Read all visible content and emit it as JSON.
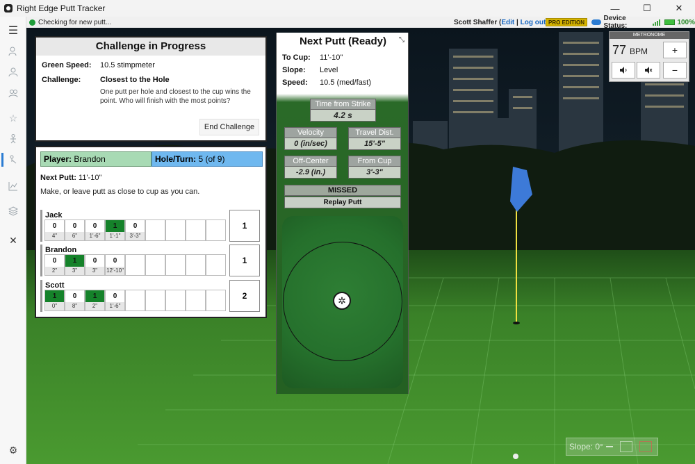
{
  "window": {
    "title": "Right Edge Putt Tracker",
    "controls": {
      "minimize": "—",
      "maximize": "☐",
      "close": "✕"
    }
  },
  "status": {
    "message": "Checking for new putt...",
    "user_name": "Scott Shaffer",
    "edit_label": "Edit",
    "separator": "|",
    "logout_label": "Log out",
    "paren_open": "(",
    "paren_close": ")",
    "edition_badge": "PRO EDITION",
    "device_label": "Device Status:",
    "battery": "100%"
  },
  "sidebar": {
    "icons": [
      "menu-icon",
      "user-settings-icon",
      "user-icon",
      "users-icon",
      "star-icon",
      "golfer-icon",
      "putt-icon",
      "chart-icon",
      "layers-icon",
      "close-icon",
      "settings-icon"
    ]
  },
  "challenge": {
    "title": "Challenge in Progress",
    "green_speed_label": "Green Speed:",
    "green_speed_value": "10.5 stimpmeter",
    "challenge_label": "Challenge:",
    "challenge_name": "Closest to the Hole",
    "challenge_desc": "One putt per hole and closest to the cup wins the point. Who will finish with the most points?",
    "end_button": "End Challenge"
  },
  "turn": {
    "player_label": "Player:",
    "player_name": "Brandon",
    "hole_label": "Hole/Turn:",
    "hole_value": "5 (of 9)",
    "next_putt_label": "Next Putt:",
    "next_putt_value": "11'-10\"",
    "instruction": "Make, or leave putt as close to cup as you can."
  },
  "scoreboard": [
    {
      "name": "Jack",
      "total": "1",
      "holes": [
        {
          "score": "0",
          "dist": "4\"",
          "made": false
        },
        {
          "score": "0",
          "dist": "6\"",
          "made": false
        },
        {
          "score": "0",
          "dist": "1'-6\"",
          "made": false
        },
        {
          "score": "1",
          "dist": "1'-1\"",
          "made": true
        },
        {
          "score": "0",
          "dist": "3'-3\"",
          "made": false
        },
        {
          "score": "",
          "dist": "",
          "made": false
        },
        {
          "score": "",
          "dist": "",
          "made": false
        },
        {
          "score": "",
          "dist": "",
          "made": false
        },
        {
          "score": "",
          "dist": "",
          "made": false
        }
      ]
    },
    {
      "name": "Brandon",
      "total": "1",
      "holes": [
        {
          "score": "0",
          "dist": "2\"",
          "made": false
        },
        {
          "score": "1",
          "dist": "3\"",
          "made": true
        },
        {
          "score": "0",
          "dist": "3\"",
          "made": false
        },
        {
          "score": "0",
          "dist": "12'-10\"",
          "made": false
        },
        {
          "score": "",
          "dist": "",
          "made": false
        },
        {
          "score": "",
          "dist": "",
          "made": false
        },
        {
          "score": "",
          "dist": "",
          "made": false
        },
        {
          "score": "",
          "dist": "",
          "made": false
        },
        {
          "score": "",
          "dist": "",
          "made": false
        }
      ]
    },
    {
      "name": "Scott",
      "total": "2",
      "holes": [
        {
          "score": "1",
          "dist": "0\"",
          "made": true
        },
        {
          "score": "0",
          "dist": "8\"",
          "made": false
        },
        {
          "score": "1",
          "dist": "2\"",
          "made": true
        },
        {
          "score": "0",
          "dist": "1'-6\"",
          "made": false
        },
        {
          "score": "",
          "dist": "",
          "made": false
        },
        {
          "score": "",
          "dist": "",
          "made": false
        },
        {
          "score": "",
          "dist": "",
          "made": false
        },
        {
          "score": "",
          "dist": "",
          "made": false
        },
        {
          "score": "",
          "dist": "",
          "made": false
        }
      ]
    }
  ],
  "next_putt": {
    "title": "Next Putt (Ready)",
    "to_cup_label": "To Cup:",
    "to_cup_value": "11'-10\"",
    "slope_label": "Slope:",
    "slope_value": "Level",
    "speed_label": "Speed:",
    "speed_value": "10.5 (med/fast)",
    "strike_label": "Time from Strike",
    "strike_value": "4.2 s",
    "velocity_label": "Velocity",
    "velocity_value": "0 (in/sec)",
    "travel_label": "Travel Dist.",
    "travel_value": "15'-5\"",
    "offcenter_label": "Off-Center",
    "offcenter_value": "-2.9 (in.)",
    "fromcup_label": "From Cup",
    "fromcup_value": "3'-3\"",
    "result": "MISSED",
    "replay_button": "Replay Putt"
  },
  "metronome": {
    "title": "METRONOME",
    "bpm_value": "77",
    "bpm_unit": "BPM",
    "plus": "+",
    "minus": "−"
  },
  "slope_widget": {
    "label": "Slope: 0°"
  },
  "colors": {
    "made_green": "#15822a",
    "player_bg": "#a8dab4",
    "hole_bg": "#6fb8ef",
    "pro_badge": "#d4b300"
  }
}
